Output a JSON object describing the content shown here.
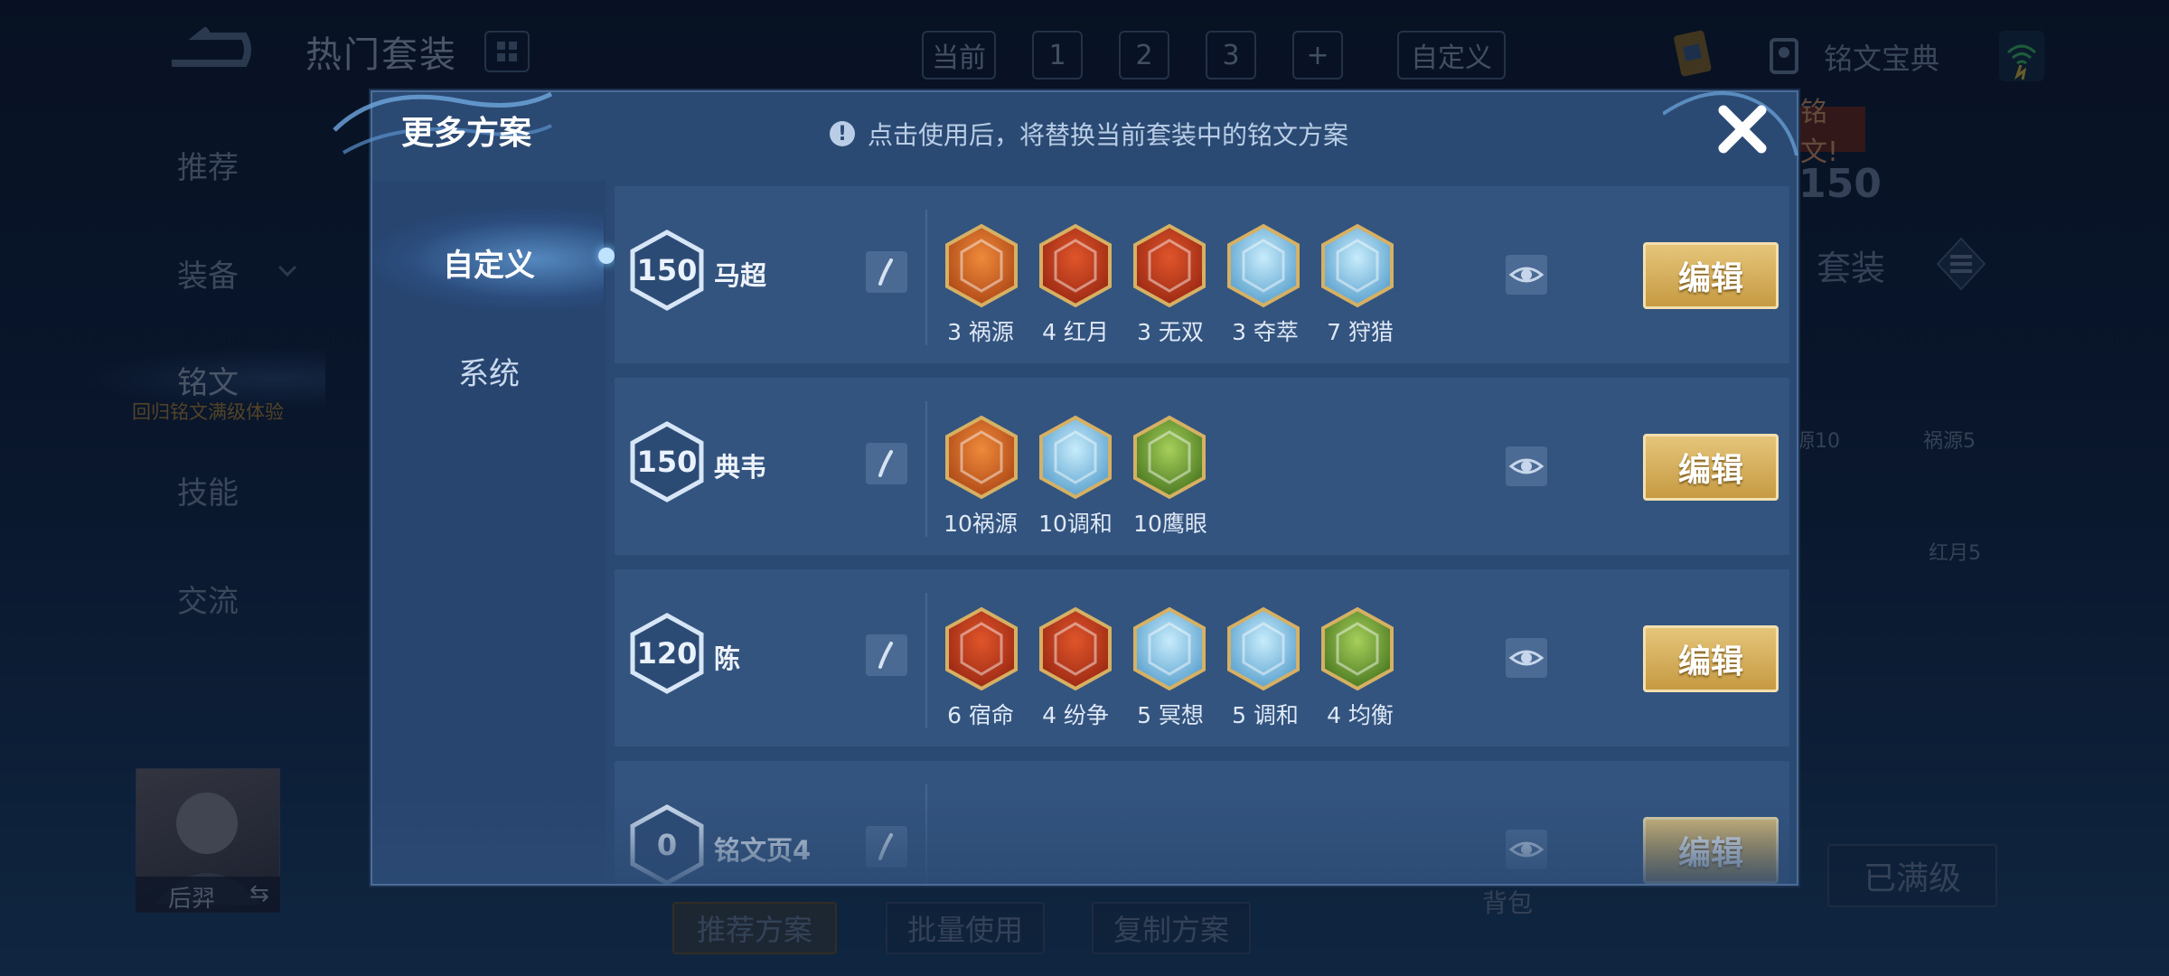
{
  "background": {
    "page_title": "热门套装",
    "top_tabs": [
      "当前",
      "1",
      "2",
      "3",
      "+",
      "自定义"
    ],
    "codex_label": "铭文宝典",
    "nav": [
      "推荐",
      "装备",
      "铭文",
      "技能",
      "交流"
    ],
    "nav_sub": "回归铭文满级体验",
    "hero_name": "后羿",
    "right_banner": "铭文!",
    "right_level": "150",
    "right_set": "套装",
    "right_runes": [
      "源10",
      "祸源5",
      "红月5"
    ],
    "bag_label": "背包",
    "maxed_label": "已满级",
    "bottom_buttons": [
      "推荐方案",
      "批量使用",
      "复制方案"
    ]
  },
  "modal": {
    "title": "更多方案",
    "notice": "点击使用后，将替换当前套装中的铭文方案",
    "notice_icon": "!",
    "tabs": [
      {
        "label": "自定义",
        "active": true
      },
      {
        "label": "系统",
        "active": false
      }
    ],
    "edit_label": "编辑",
    "pages": [
      {
        "level": "150",
        "name": "马超",
        "runes": [
          {
            "label": "3 祸源",
            "color": "orange"
          },
          {
            "label": "4 红月",
            "color": "red"
          },
          {
            "label": "3 无双",
            "color": "red"
          },
          {
            "label": "3 夺萃",
            "color": "blue"
          },
          {
            "label": "7 狩猎",
            "color": "blue"
          }
        ]
      },
      {
        "level": "150",
        "name": "典韦",
        "runes": [
          {
            "label": "10祸源",
            "color": "orange"
          },
          {
            "label": "10调和",
            "color": "blue"
          },
          {
            "label": "10鹰眼",
            "color": "green"
          }
        ]
      },
      {
        "level": "120",
        "name": "陈",
        "runes": [
          {
            "label": "6 宿命",
            "color": "red"
          },
          {
            "label": "4 纷争",
            "color": "red"
          },
          {
            "label": "5 冥想",
            "color": "blue"
          },
          {
            "label": "5 调和",
            "color": "blue"
          },
          {
            "label": "4 均衡",
            "color": "green"
          }
        ]
      },
      {
        "level": "0",
        "name": "铭文页4",
        "runes": []
      }
    ]
  },
  "colors": {
    "gold": "#d6b063",
    "rune_red": "#c8401f",
    "rune_orange": "#d9622a",
    "rune_blue": "#8fc6e6",
    "rune_green": "#7fa83a"
  }
}
